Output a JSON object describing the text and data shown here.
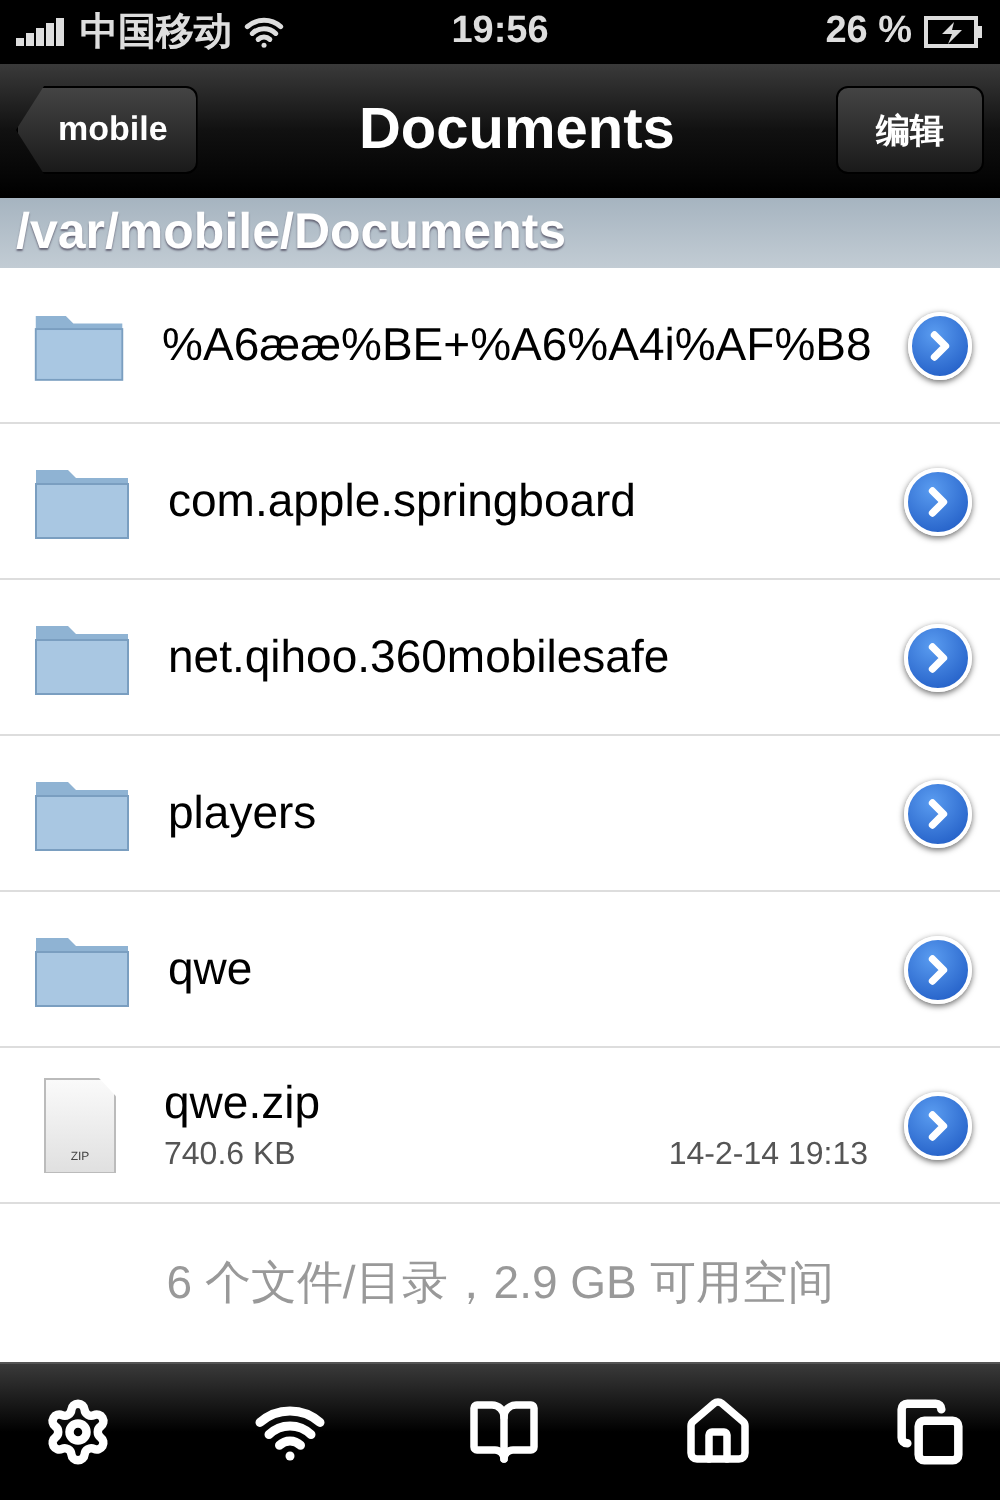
{
  "status_bar": {
    "carrier": "中国移动",
    "time": "19:56",
    "battery": "26 %"
  },
  "nav_bar": {
    "back": "mobile",
    "title": "Documents",
    "edit": "编辑"
  },
  "path": "/var/mobile/Documents",
  "items": [
    {
      "kind": "folder",
      "name": "%A6ææ%BE+%A6%A4i%AF%B8"
    },
    {
      "kind": "folder",
      "name": "com.apple.springboard"
    },
    {
      "kind": "folder",
      "name": "net.qihoo.360mobilesafe"
    },
    {
      "kind": "folder",
      "name": "players"
    },
    {
      "kind": "folder",
      "name": "qwe"
    },
    {
      "kind": "file",
      "name": "qwe.zip",
      "icon_label": "ZIP",
      "size": "740.6 KB",
      "date": "14-2-14 19:13"
    }
  ],
  "summary": "6 个文件/目录，2.9 GB 可用空间"
}
